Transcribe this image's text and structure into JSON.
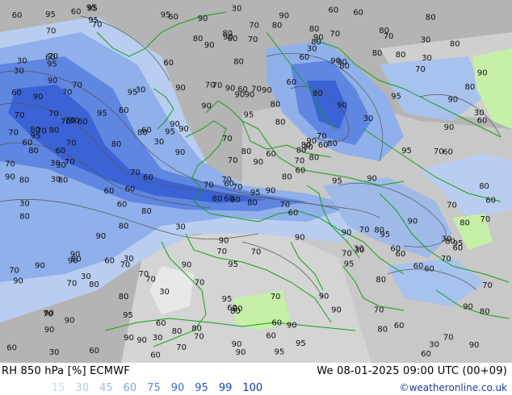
{
  "footer": {
    "title": "RH 850 hPa [%] ECMWF",
    "valid_time": "We 08-01-2025 09:00 UTC (00+09)",
    "credit": "©weatheronline.co.uk"
  },
  "legend": {
    "levels": [
      {
        "label": "15",
        "color": "#c8d8f0"
      },
      {
        "label": "30",
        "color": "#b4c8ec"
      },
      {
        "label": "45",
        "color": "#a0bae8"
      },
      {
        "label": "60",
        "color": "#7aa2e6"
      },
      {
        "label": "75",
        "color": "#5c88e0"
      },
      {
        "label": "90",
        "color": "#3f6bd8"
      },
      {
        "label": "95",
        "color": "#2a55cf"
      },
      {
        "label": "99",
        "color": "#1c40c2"
      },
      {
        "label": "100",
        "color": "#1030b4"
      }
    ]
  },
  "map": {
    "colors": {
      "dry_gray": "#a8a8a8",
      "mid_gray": "#c4c4c4",
      "light_gray": "#dadada",
      "moist_light": "#b8cdf0",
      "moist_mid": "#8fb0ea",
      "moist_high": "#5f86e0",
      "saturated": "#3b63d6",
      "very_dry_green": "#c6f0a8",
      "border": "#16a016"
    },
    "contour_labels": [
      "80",
      "70",
      "60",
      "90",
      "80",
      "70",
      "70",
      "70",
      "90",
      "80",
      "70",
      "90",
      "70",
      "90",
      "80",
      "90",
      "60",
      "90",
      "80",
      "30",
      "90",
      "90",
      "95",
      "60",
      "30",
      "95",
      "70",
      "60",
      "80",
      "90",
      "60",
      "70",
      "95",
      "70",
      "30",
      "80",
      "70",
      "30",
      "90",
      "80",
      "90",
      "95",
      "80",
      "95",
      "90",
      "70",
      "70",
      "30",
      "80",
      "60",
      "70",
      "90",
      "30",
      "30",
      "90",
      "80",
      "95",
      "95",
      "70",
      "30",
      "70",
      "60",
      "70",
      "60",
      "80",
      "95",
      "90",
      "90",
      "80",
      "70",
      "95",
      "80",
      "70",
      "80",
      "70",
      "70",
      "95",
      "80",
      "70",
      "60",
      "60",
      "90",
      "95",
      "95",
      "90",
      "60",
      "70",
      "60",
      "95",
      "90",
      "80",
      "60",
      "80",
      "80",
      "90",
      "70",
      "95",
      "90",
      "90",
      "80",
      "60",
      "95",
      "80",
      "60",
      "90",
      "70",
      "60",
      "80",
      "70",
      "90",
      "70",
      "95",
      "90",
      "70",
      "60",
      "90",
      "90",
      "80",
      "70",
      "90",
      "90",
      "80",
      "80",
      "90",
      "90",
      "80",
      "70",
      "70",
      "95",
      "90",
      "80",
      "95",
      "60",
      "60",
      "80",
      "60",
      "80",
      "90",
      "70",
      "90",
      "70",
      "70",
      "60",
      "90",
      "90",
      "70",
      "80",
      "80",
      "60",
      "90",
      "90",
      "95",
      "80",
      "70",
      "90",
      "80",
      "80",
      "95",
      "60",
      "60",
      "90",
      "70",
      "90",
      "30",
      "80",
      "70",
      "90",
      "80",
      "95",
      "60",
      "60",
      "90",
      "70",
      "80",
      "70",
      "30",
      "60",
      "70",
      "60",
      "70",
      "90",
      "95",
      "60",
      "80",
      "60",
      "60",
      "70",
      "60",
      "30",
      "70",
      "80",
      "90",
      "90",
      "95",
      "80",
      "80",
      "80",
      "70",
      "60",
      "60",
      "30",
      "80",
      "90",
      "70",
      "30",
      "80",
      "60",
      "90",
      "70",
      "70",
      "70",
      "80",
      "30",
      "60",
      "70",
      "70",
      "80",
      "60",
      "30",
      "30",
      "80",
      "90",
      "60",
      "80",
      "90",
      "30",
      "60",
      "30",
      "60",
      "70",
      "60",
      "30",
      "60",
      "60",
      "60",
      "30",
      "70",
      "30",
      "30",
      "30",
      "30",
      "30",
      "60",
      "30"
    ]
  }
}
